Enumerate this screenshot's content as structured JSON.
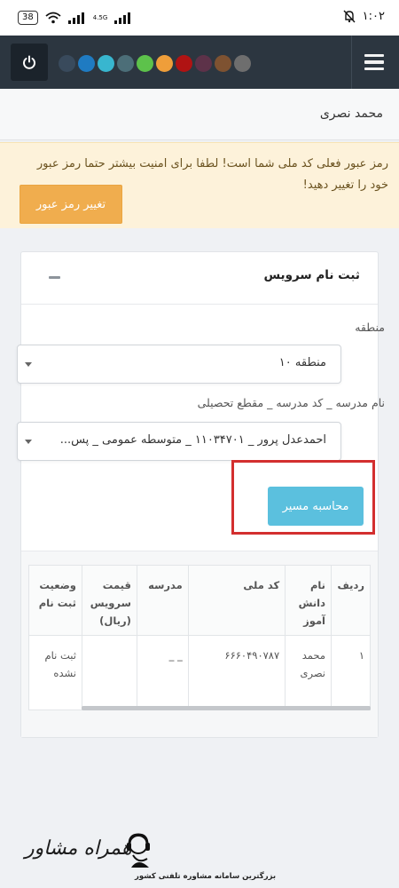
{
  "status_bar": {
    "battery": "38",
    "network": "4.5G",
    "time": "۱:۰۲"
  },
  "header": {
    "swatches": [
      "#394a5c",
      "#1f7bc2",
      "#38b6cf",
      "#4c6e78",
      "#5dc24b",
      "#ef9e3a",
      "#b01313",
      "#5d3249",
      "#7e5231",
      "#6e6e6e"
    ],
    "power_icon": "power-icon",
    "menu_icon": "hamburger-icon"
  },
  "user": {
    "name": "محمد نصری"
  },
  "alert": {
    "message": "رمز عبور فعلی کد ملی شما است! لطفا برای امنیت بیشتر حتما رمز عبور خود را تغییر دهید!",
    "button": "تغییر رمز عبور"
  },
  "service_card": {
    "title": "ثبت نام سرویس",
    "region_label": "منطقه",
    "region_value": "منطقه ۱۰",
    "school_label": "نام مدرسه _ کد مدرسه _ مقطع تحصیلی",
    "school_value": "احمدعدل پرور _ ۱۱۰۳۴۷۰۱ _ متوسطه عمومی _ پس...",
    "route_button": "محاسبه مسیر"
  },
  "table": {
    "headers": {
      "row": "ردیف",
      "student": "نام دانش آموز",
      "national_code": "کد ملی",
      "school": "مدرسه",
      "price": "قیمت سرویس (ریال)",
      "status": "وضعیت ثبت نام"
    },
    "rows": [
      {
        "row": "۱",
        "student": "محمد نصری",
        "national_code": "۶۶۶۰۴۹۰۷۸۷",
        "school": "_ _",
        "price": "",
        "status": "ثبت نام نشده"
      }
    ]
  },
  "branding": {
    "title": "همراه مشاور",
    "subtitle": "بزرگترین سامانه مشاوره تلفنی کشور"
  }
}
